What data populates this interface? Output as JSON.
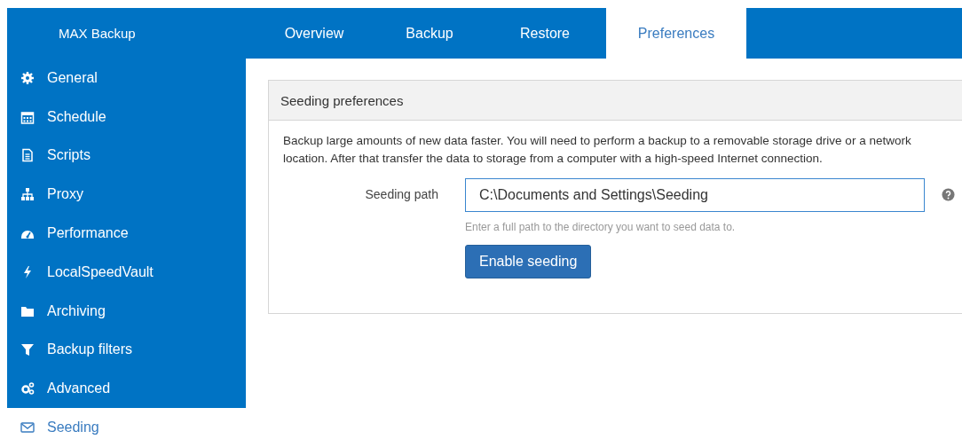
{
  "app": {
    "title": "MAX Backup"
  },
  "tabs": [
    {
      "label": "Overview",
      "selected": false
    },
    {
      "label": "Backup",
      "selected": false
    },
    {
      "label": "Restore",
      "selected": false
    },
    {
      "label": "Preferences",
      "selected": true
    }
  ],
  "sidebar": {
    "items": [
      {
        "label": "General",
        "selected": false
      },
      {
        "label": "Schedule",
        "selected": false
      },
      {
        "label": "Scripts",
        "selected": false
      },
      {
        "label": "Proxy",
        "selected": false
      },
      {
        "label": "Performance",
        "selected": false
      },
      {
        "label": "LocalSpeedVault",
        "selected": false
      },
      {
        "label": "Archiving",
        "selected": false
      },
      {
        "label": "Backup filters",
        "selected": false
      },
      {
        "label": "Advanced",
        "selected": false
      },
      {
        "label": "Seeding",
        "selected": true
      }
    ]
  },
  "panel": {
    "title": "Seeding preferences",
    "description": "Backup large amounts of new data faster. You will need to perform a backup to a removable storage drive or a network location. After that transfer the data to storage from a computer with a high-speed Internet connection.",
    "field": {
      "label": "Seeding path",
      "value": "C:\\Documents and Settings\\Seeding",
      "hint": "Enter a full path to the directory you want to seed data to."
    },
    "button": "Enable seeding"
  }
}
